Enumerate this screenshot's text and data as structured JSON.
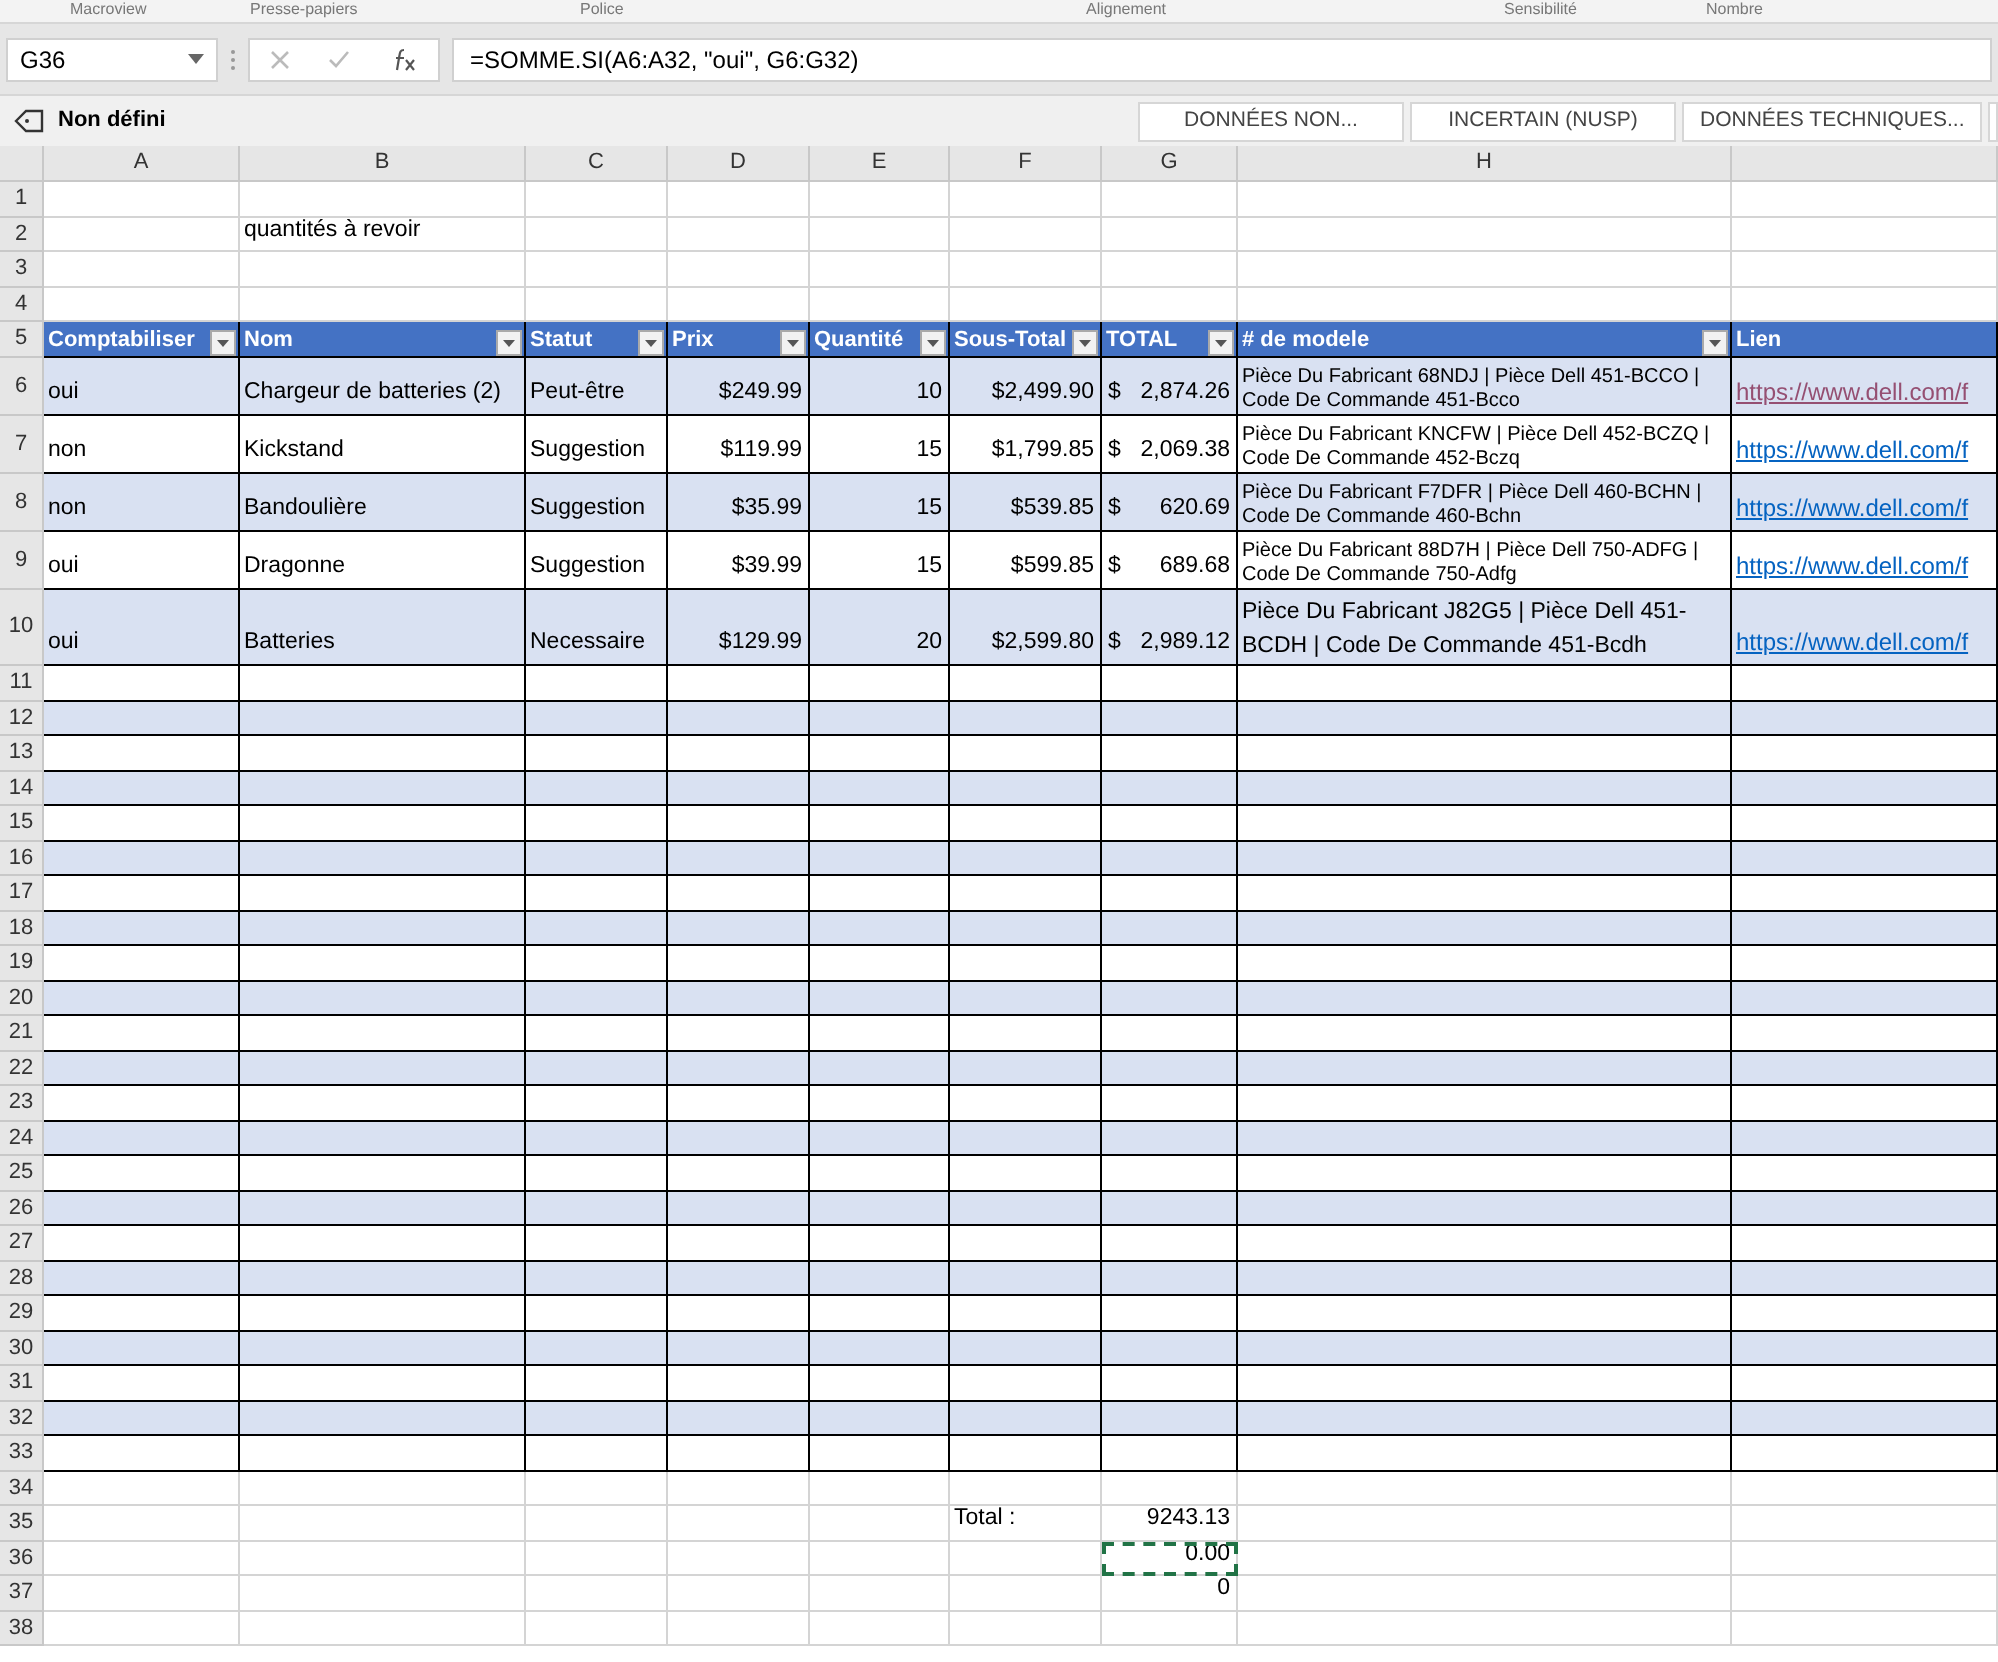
{
  "ribbon_groups": [
    "Macroview",
    "Presse-papiers",
    "Police",
    "Alignement",
    "Sensibilité",
    "Nombre"
  ],
  "name_box": "G36",
  "formula": "=SOMME.SI(A6:A32, \"oui\", G6:G32)",
  "sensitivity": {
    "label": "Non défini",
    "buttons": [
      "DONNÉES NON...",
      "INCERTAIN (NUSP)",
      "DONNÉES TECHNIQUES..."
    ]
  },
  "column_headers": [
    "A",
    "B",
    "C",
    "D",
    "E",
    "F",
    "G",
    "H"
  ],
  "rows": [
    {
      "number": "1",
      "kind": "plain"
    },
    {
      "number": "2",
      "kind": "plain",
      "note": "quantités à revoir"
    },
    {
      "number": "3",
      "kind": "plain"
    },
    {
      "number": "4",
      "kind": "plain"
    },
    {
      "number": "5",
      "kind": "table_header",
      "columns": [
        {
          "label": "Comptabiliser",
          "filter": true
        },
        {
          "label": "Nom",
          "filter": true
        },
        {
          "label": "Statut",
          "filter": true
        },
        {
          "label": "Prix",
          "filter": true
        },
        {
          "label": "Quantité",
          "filter": true
        },
        {
          "label": "Sous-Total",
          "filter": true
        },
        {
          "label": "TOTAL",
          "filter": true
        },
        {
          "label": "# de modele",
          "filter": true
        },
        {
          "label": "Lien",
          "filter": false
        }
      ]
    },
    {
      "number": "6",
      "kind": "table_row",
      "cells": [
        "oui",
        "Chargeur de batteries (2)",
        "Peut-être",
        "$249.99",
        "10",
        "$2,499.90"
      ],
      "total": {
        "symbol": "$",
        "amount": "2,874.26"
      },
      "model": "Pièce Du Fabricant 68NDJ | Pièce Dell 451-BCCO |  Code De Commande 451-Bcco",
      "link": {
        "text": "https://www.dell.com/f",
        "visited": true
      }
    },
    {
      "number": "7",
      "kind": "table_row",
      "cells": [
        "non",
        "Kickstand",
        "Suggestion",
        "$119.99",
        "15",
        "$1,799.85"
      ],
      "total": {
        "symbol": "$",
        "amount": "2,069.38"
      },
      "model": "Pièce Du Fabricant KNCFW | Pièce Dell 452-BCZQ |  Code De Commande 452-Bczq",
      "link": {
        "text": "https://www.dell.com/f",
        "visited": false
      }
    },
    {
      "number": "8",
      "kind": "table_row",
      "cells": [
        "non",
        "Bandoulière",
        "Suggestion",
        "$35.99",
        "15",
        "$539.85"
      ],
      "total": {
        "symbol": "$",
        "amount": "620.69"
      },
      "model": "Pièce Du Fabricant F7DFR | Pièce Dell 460-BCHN | Code De Commande 460-Bchn",
      "link": {
        "text": "https://www.dell.com/f",
        "visited": false
      }
    },
    {
      "number": "9",
      "kind": "table_row",
      "cells": [
        "oui",
        "Dragonne",
        "Suggestion",
        "$39.99",
        "15",
        "$599.85"
      ],
      "total": {
        "symbol": "$",
        "amount": "689.68"
      },
      "model": "Pièce Du Fabricant 88D7H | Pièce Dell 750-ADFG | Code De Commande 750-Adfg",
      "link": {
        "text": "https://www.dell.com/f",
        "visited": false
      }
    },
    {
      "number": "10",
      "kind": "table_row",
      "tall": true,
      "cells": [
        "oui",
        "Batteries",
        "Necessaire",
        "$129.99",
        "20",
        "$2,599.80"
      ],
      "total": {
        "symbol": "$",
        "amount": "2,989.12"
      },
      "model": "Pièce Du Fabricant J82G5 | Pièce Dell 451-BCDH | Code De Commande 451-Bcdh",
      "link": {
        "text": "https://www.dell.com/f",
        "visited": false
      }
    },
    {
      "number": "11",
      "kind": "table_empty"
    },
    {
      "number": "12",
      "kind": "table_empty"
    },
    {
      "number": "13",
      "kind": "table_empty"
    },
    {
      "number": "14",
      "kind": "table_empty"
    },
    {
      "number": "15",
      "kind": "table_empty"
    },
    {
      "number": "16",
      "kind": "table_empty"
    },
    {
      "number": "17",
      "kind": "table_empty"
    },
    {
      "number": "18",
      "kind": "table_empty"
    },
    {
      "number": "19",
      "kind": "table_empty"
    },
    {
      "number": "20",
      "kind": "table_empty"
    },
    {
      "number": "21",
      "kind": "table_empty"
    },
    {
      "number": "22",
      "kind": "table_empty"
    },
    {
      "number": "23",
      "kind": "table_empty"
    },
    {
      "number": "24",
      "kind": "table_empty"
    },
    {
      "number": "25",
      "kind": "table_empty"
    },
    {
      "number": "26",
      "kind": "table_empty"
    },
    {
      "number": "27",
      "kind": "table_empty"
    },
    {
      "number": "28",
      "kind": "table_empty"
    },
    {
      "number": "29",
      "kind": "table_empty"
    },
    {
      "number": "30",
      "kind": "table_empty"
    },
    {
      "number": "31",
      "kind": "table_empty"
    },
    {
      "number": "32",
      "kind": "table_empty"
    },
    {
      "number": "33",
      "kind": "table_empty"
    },
    {
      "number": "34",
      "kind": "plain"
    },
    {
      "number": "35",
      "kind": "plain",
      "label": "Total :",
      "value": "9243.13",
      "selected": false
    },
    {
      "number": "36",
      "kind": "plain",
      "value": "0.00",
      "selected": true
    },
    {
      "number": "37",
      "kind": "plain",
      "value": "0",
      "selected": false
    },
    {
      "number": "38",
      "kind": "plain"
    }
  ]
}
